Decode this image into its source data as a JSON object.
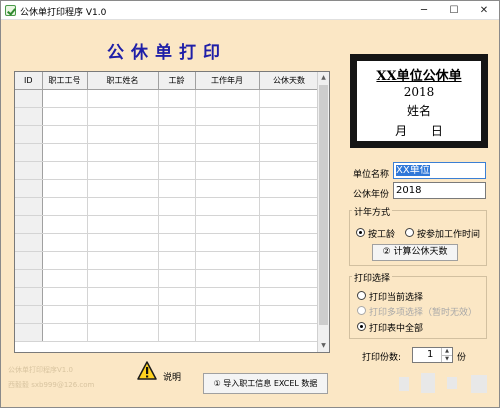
{
  "window": {
    "title": "公休单打印程序 V1.0",
    "controls": {
      "minimize": "─",
      "maximize": "☐",
      "close": "✕"
    }
  },
  "main": {
    "big_title": "公休单打印",
    "grid": {
      "columns": [
        "ID",
        "职工工号",
        "职工姓名",
        "工龄",
        "工作年月",
        "公休天数"
      ],
      "empty_rows": 14
    },
    "footer": {
      "line1": "公休单打印程序V1.0",
      "line2": "西毅毅 sxb999@126.com",
      "explain_label": "说明",
      "import_button": "① 导入职工信息 EXCEL 数据"
    }
  },
  "preview_card": {
    "title": "XX单位公休单",
    "year": "2018",
    "name": "姓名",
    "month_day": "月 日"
  },
  "form": {
    "unit_name_label": "单位名称",
    "unit_name_value": "XX单位",
    "year_label": "公休年份",
    "year_value": "2018",
    "calc_method": {
      "title": "计年方式",
      "options": [
        "按工龄",
        "按参加工作时间"
      ],
      "selected": "按工龄",
      "calc_button": "② 计算公休天数"
    },
    "print_select": {
      "title": "打印选择",
      "options": [
        "打印当前选择",
        "打印多项选择（暂时无效）",
        "打印表中全部"
      ],
      "selected": "打印表中全部",
      "disabled": "打印多项选择（暂时无效）"
    },
    "copies_label": "打印份数:",
    "copies_value": "1",
    "copies_unit": "份"
  },
  "colors": {
    "window_bg": "#fbe7c5",
    "title_blue": "#1f1fa8",
    "selection": "#3078d8"
  },
  "icons": [
    "app-check-icon",
    "warning-icon",
    "spin-up-icon",
    "spin-down-icon",
    "scroll-up-icon",
    "scroll-down-icon"
  ]
}
